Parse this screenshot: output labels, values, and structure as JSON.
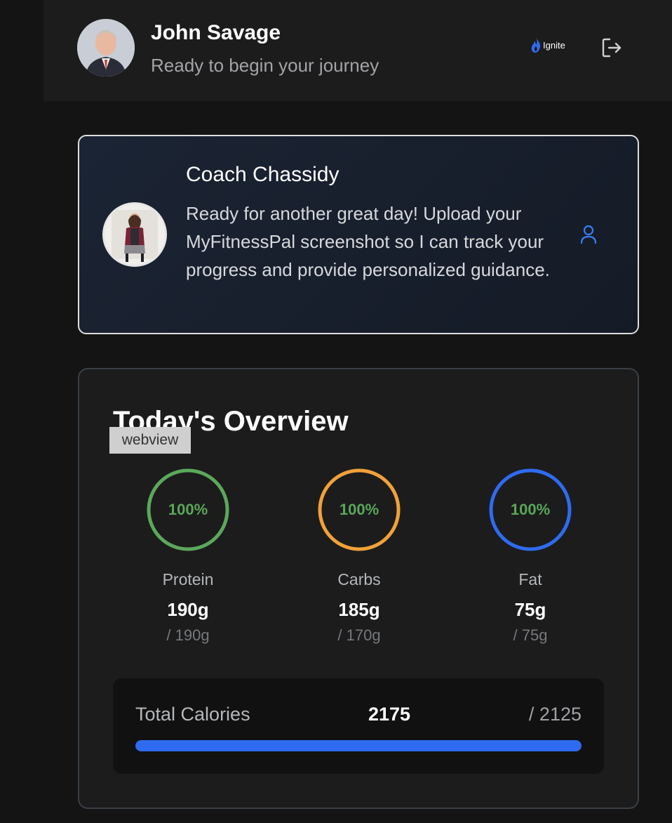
{
  "header": {
    "user_name": "John Savage",
    "subtitle": "Ready to begin your journey",
    "brand_name": "Ignite",
    "avatar_icon": "user-photo-avatar",
    "logout_icon": "logout-icon"
  },
  "coach": {
    "name": "Coach Chassidy",
    "message": "Ready for another great day! Upload your MyFitnessPal screenshot so I can track your progress and provide personalized guidance.",
    "avatar_icon": "coach-photo-avatar",
    "profile_icon": "person-icon"
  },
  "overview": {
    "title": "Today's Overview",
    "overlay_tag": "webview",
    "macros": [
      {
        "label": "Protein",
        "percent_text": "100%",
        "value": "190g",
        "goal": "/ 190g",
        "ring_color": "#5ba85b",
        "progress": 1.0
      },
      {
        "label": "Carbs",
        "percent_text": "100%",
        "value": "185g",
        "goal": "/ 170g",
        "ring_color": "#f0a13a",
        "progress": 1.0
      },
      {
        "label": "Fat",
        "percent_text": "100%",
        "value": "75g",
        "goal": "/ 75g",
        "ring_color": "#2f6bf0",
        "progress": 1.0
      }
    ],
    "calories": {
      "label": "Total Calories",
      "value": "2175",
      "goal": "/ 2125",
      "progress": 1.0,
      "bar_color": "#2f6bf0"
    }
  },
  "colors": {
    "background": "#141414",
    "card": "#1c1c1c",
    "accent_blue": "#2f6bf0",
    "percent_green": "#5aa65a"
  }
}
